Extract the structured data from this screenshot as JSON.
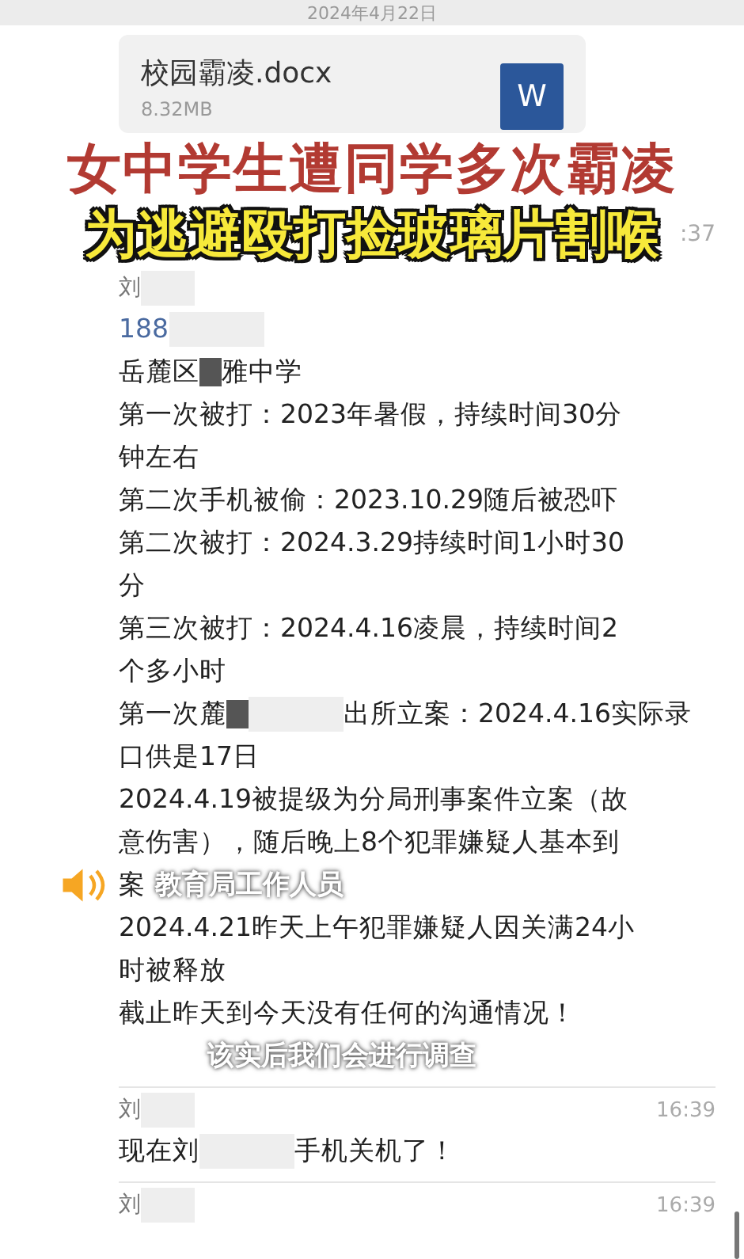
{
  "date_divider": "2024年4月22日",
  "file_message": {
    "name": "校园霸凌.docx",
    "size": "8.32MB",
    "icon_letter": "W"
  },
  "captions": {
    "headline": "女中学生遭同学多次霸凌",
    "subheadline": "为逃避殴打捡玻璃片割喉",
    "partial_time": ":37"
  },
  "messages": [
    {
      "sender": "刘",
      "sender_redacted": true,
      "lines": [
        [
          {
            "kind": "phone",
            "text": "188"
          },
          {
            "kind": "redaction"
          }
        ],
        [
          {
            "kind": "text",
            "text": "岳麓区"
          },
          {
            "kind": "blur"
          },
          {
            "kind": "text",
            "text": "雅中学"
          }
        ],
        [
          {
            "kind": "text",
            "text": "第一次被打：2023年暑假，持续时间30分"
          }
        ],
        [
          {
            "kind": "text",
            "text": "钟左右"
          }
        ],
        [
          {
            "kind": "text",
            "text": "第二次手机被偷：2023.10.29随后被恐吓"
          }
        ],
        [
          {
            "kind": "text",
            "text": "第二次被打：2024.3.29持续时间1小时30"
          }
        ],
        [
          {
            "kind": "text",
            "text": "分"
          }
        ],
        [
          {
            "kind": "text",
            "text": "第三次被打：2024.4.16凌晨，持续时间2"
          }
        ],
        [
          {
            "kind": "text",
            "text": "个多小时"
          }
        ],
        [
          {
            "kind": "text",
            "text": "第一次麓"
          },
          {
            "kind": "blur"
          },
          {
            "kind": "redaction"
          },
          {
            "kind": "text",
            "text": "出所立案：2024.4.16实际录"
          }
        ],
        [
          {
            "kind": "text",
            "text": "口供是17日"
          }
        ],
        [
          {
            "kind": "text",
            "text": "2024.4.19被提级为分局刑事案件立案（故"
          }
        ],
        [
          {
            "kind": "text",
            "text": "意伤害），随后晚上8个犯罪嫌疑人基本到"
          }
        ],
        [
          {
            "kind": "text",
            "text": "案"
          },
          {
            "kind": "subtitle",
            "text": "教育局工作人员"
          }
        ],
        [
          {
            "kind": "text",
            "text": "2024.4.21昨天上午犯罪嫌疑人因关满24小"
          }
        ],
        [
          {
            "kind": "text",
            "text": "时被释放"
          }
        ],
        [
          {
            "kind": "text",
            "text": "截止昨天到今天没有任何的沟通情况！"
          }
        ],
        [
          {
            "kind": "subtitle",
            "text": "该实后我们会进行调查"
          }
        ]
      ]
    },
    {
      "sender": "刘",
      "sender_redacted": true,
      "time": "16:39",
      "lines": [
        [
          {
            "kind": "text",
            "text": "现在刘"
          },
          {
            "kind": "redaction"
          },
          {
            "kind": "text",
            "text": "手机关机了！"
          }
        ]
      ]
    },
    {
      "sender": "刘",
      "sender_redacted": true,
      "time": "16:39"
    }
  ]
}
